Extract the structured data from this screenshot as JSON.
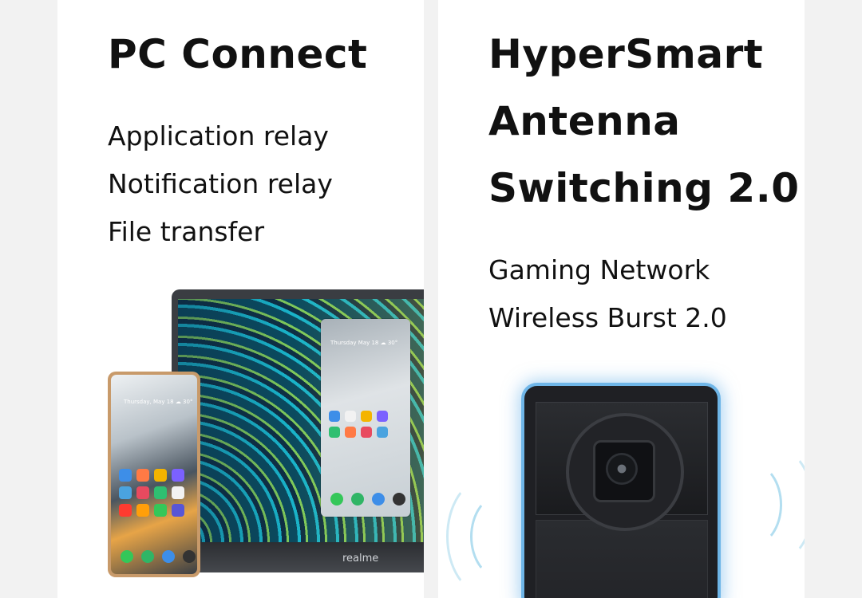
{
  "cards": [
    {
      "title": "PC Connect",
      "features": [
        "Application relay",
        "Notification relay",
        "File transfer"
      ],
      "laptop_brand": "realme",
      "phone_date": "Thursday, May 18  ☁ 30°",
      "mirror_date": "Thursday May 18  ☁ 30°"
    },
    {
      "title": "HyperSmart\nAntenna\nSwitching 2.0",
      "features": [
        "Gaming Network",
        "Wireless Burst 2.0"
      ]
    }
  ],
  "icons": {
    "phone": "phone-graphic",
    "laptop": "laptop-graphic",
    "antenna": "antenna-graphic"
  },
  "colors": {
    "background": "#f2f2f2",
    "card": "#ffffff",
    "text": "#111111",
    "glow": "#6fb6e8"
  }
}
